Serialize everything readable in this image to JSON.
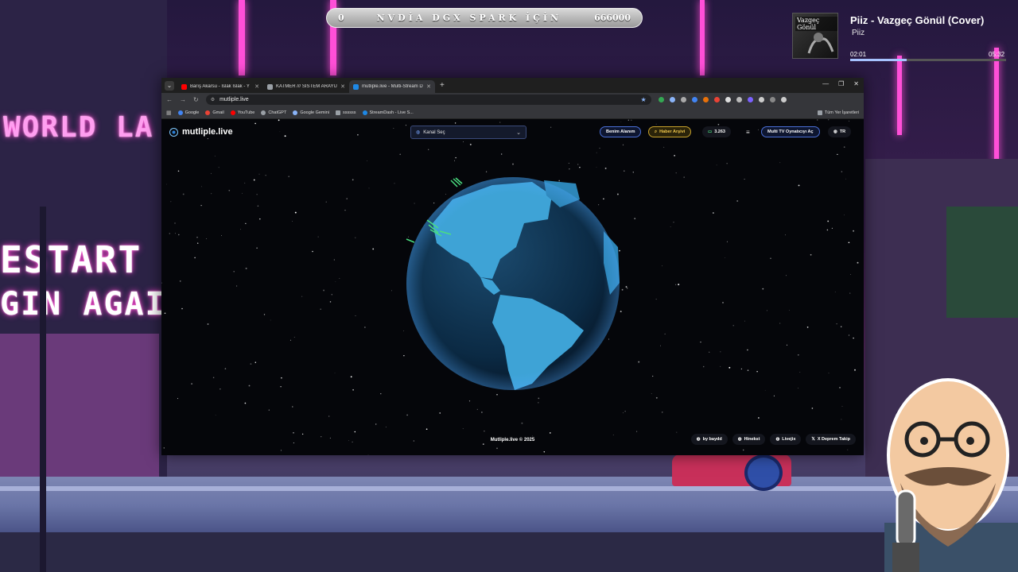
{
  "banner": {
    "left_value": "0",
    "title": "NVDİA DGX SPARK İÇİN",
    "right_value": "666000"
  },
  "now_playing": {
    "album_label": "Vazgeç Gönül",
    "title": "Piiz - Vazgeç Gönül (Cover)",
    "artist": "Piiz",
    "current_time": "02:01",
    "total_time": "05:32",
    "progress": 0.36
  },
  "scene": {
    "neon_sign_1": "WORLD LA",
    "neon_sign_2": "ESTART",
    "neon_sign_3": "GIN AGAIN"
  },
  "browser": {
    "tabs": [
      {
        "label": "Barış Akarsu - Islak Islak - Y",
        "favicon_color": "#ff0000",
        "active": false
      },
      {
        "label": "KATMER /// SİSTEM ARAYÜZÜ",
        "favicon_color": "#9aa0a6",
        "active": false
      },
      {
        "label": "mutliple.live - Multi-Stream Dü",
        "favicon_color": "#1e88e5",
        "active": true
      }
    ],
    "url": "mutliple.live",
    "bookmarks": [
      {
        "label": "Google",
        "color": "#4285f4"
      },
      {
        "label": "Gmail",
        "color": "#ea4335"
      },
      {
        "label": "YouTube",
        "color": "#ff0000"
      },
      {
        "label": "ChatGPT",
        "color": "#9aa0a6"
      },
      {
        "label": "Google Gemini",
        "color": "#8ab4f8"
      },
      {
        "label": "ssssss",
        "color": "#9aa0a6"
      },
      {
        "label": "StreamDash - Live S...",
        "color": "#1e88e5"
      }
    ],
    "bookmarks_all": "Tüm Yer İşaretleri"
  },
  "site": {
    "logo": "mutliple.live",
    "channel_select": "Kanal Seç",
    "my_area": "Benim Alanım",
    "news_archive": "Haber Arşivi",
    "viewer_count": "3.263",
    "multi_tv": "Multi TV Oynatıcıyı Aç",
    "language": "TR",
    "copyright": "Mutliple.live © 2025",
    "footer_links": [
      "by baydd",
      "Hinekst",
      "Livejix",
      "X Deprem Takip"
    ]
  },
  "colors": {
    "accent_blue": "#4a6fd6",
    "accent_gold": "#f2c94c",
    "neon_pink": "#ff4fd8",
    "ocean": "#0b2a44",
    "land": "#3ea3d6"
  }
}
